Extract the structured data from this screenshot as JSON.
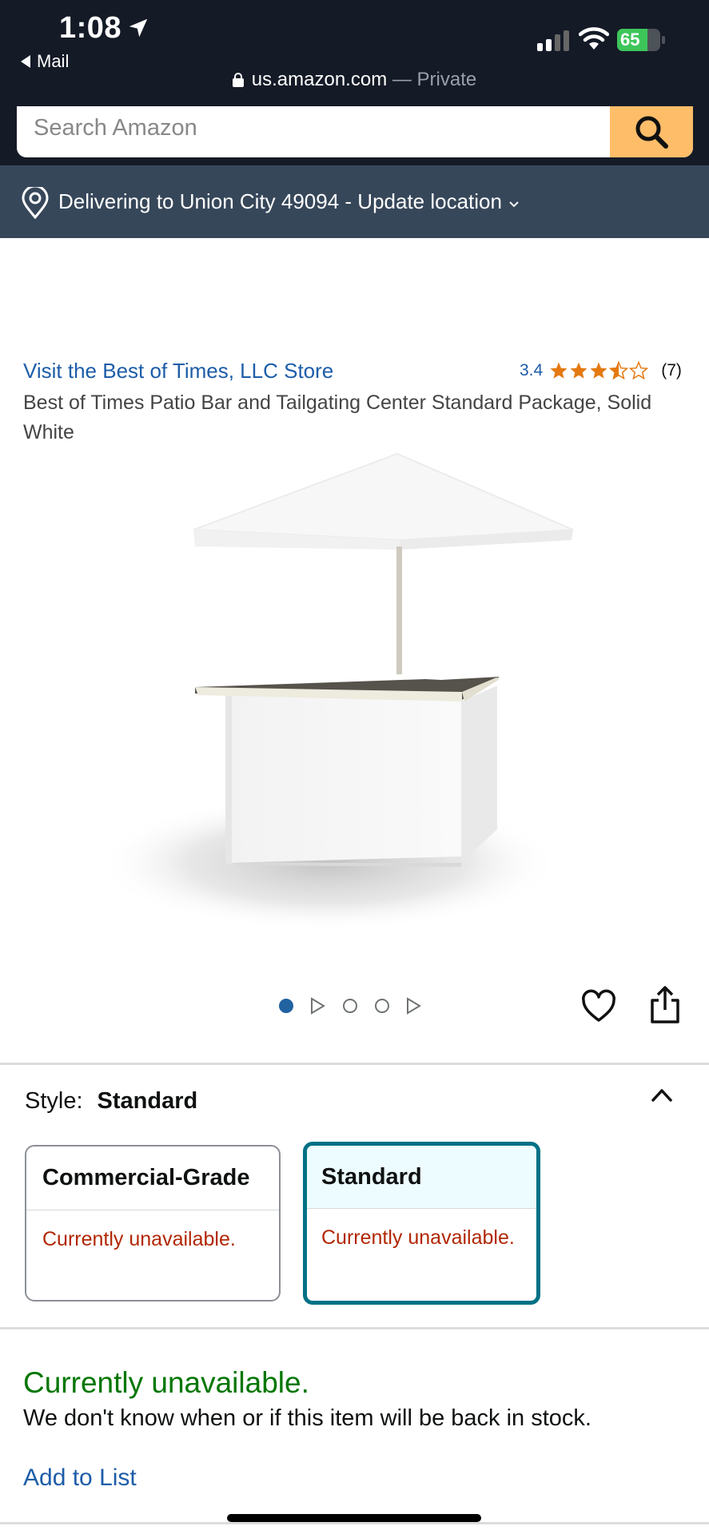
{
  "status_bar": {
    "time": "1:08",
    "back_app": "Mail",
    "battery": "65"
  },
  "browser": {
    "url": "us.amazon.com",
    "mode": " — Private"
  },
  "search": {
    "placeholder": "Search Amazon"
  },
  "delivery": {
    "text": "Delivering to Union City 49094 - Update location"
  },
  "product": {
    "store_link": "Visit the Best of Times, LLC Store",
    "rating_value": "3.4",
    "rating_count": "(7)",
    "stars_filled": 3.4,
    "title": "Best of Times Patio Bar and Tailgating Center Standard Package, Solid White"
  },
  "carousel": {
    "items": [
      "image",
      "video",
      "image",
      "image",
      "video"
    ],
    "active_index": 0
  },
  "style": {
    "label": "Style:",
    "selected": "Standard",
    "options": [
      {
        "name": "Commercial-Grade",
        "status": "Currently unavailable."
      },
      {
        "name": "Standard",
        "status": "Currently unavailable."
      }
    ]
  },
  "availability": {
    "status": "Currently unavailable.",
    "message": "We don't know when or if this item will be back in stock."
  },
  "actions": {
    "add_to_list": "Add to List"
  },
  "colors": {
    "status_bar_bg": "#141a26",
    "delivery_bg": "#37475a",
    "search_button": "#febd69",
    "link": "#1d5da8",
    "star": "#e47911",
    "selected_border": "#007185",
    "unavailable_red": "#b12704",
    "unavailable_green": "#007600"
  },
  "icons": [
    "location-arrow-icon",
    "signal-icon",
    "wifi-icon",
    "battery-icon",
    "lock-icon",
    "search-icon",
    "location-pin-icon",
    "chevron-down-icon",
    "star-icon",
    "heart-icon",
    "share-icon",
    "caret-up-icon"
  ]
}
